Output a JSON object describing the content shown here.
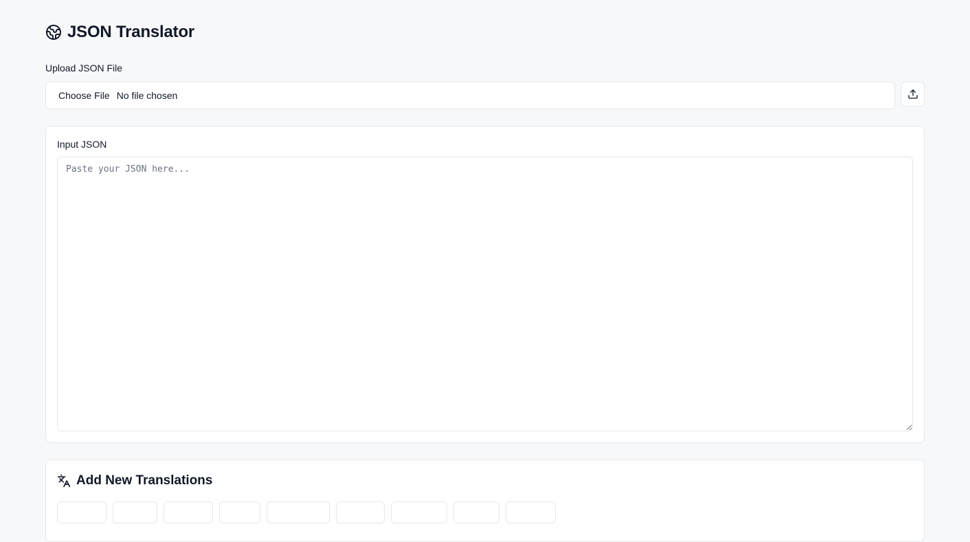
{
  "app": {
    "title": "JSON Translator",
    "icon": "globe-icon"
  },
  "upload": {
    "label": "Upload JSON File",
    "choose_label": "Choose File",
    "status": "No file chosen",
    "upload_icon": "upload-icon"
  },
  "input": {
    "label": "Input JSON",
    "placeholder": "Paste your JSON here...",
    "value": ""
  },
  "translations": {
    "title": "Add New Translations",
    "icon": "languages-icon",
    "chips": [
      "",
      "",
      "",
      "",
      "",
      "",
      "",
      "",
      ""
    ]
  },
  "colors": {
    "background": "#f7f8f9",
    "card": "#ffffff",
    "border": "#e5e7eb",
    "text": "#111827",
    "placeholder": "#6b7280"
  }
}
